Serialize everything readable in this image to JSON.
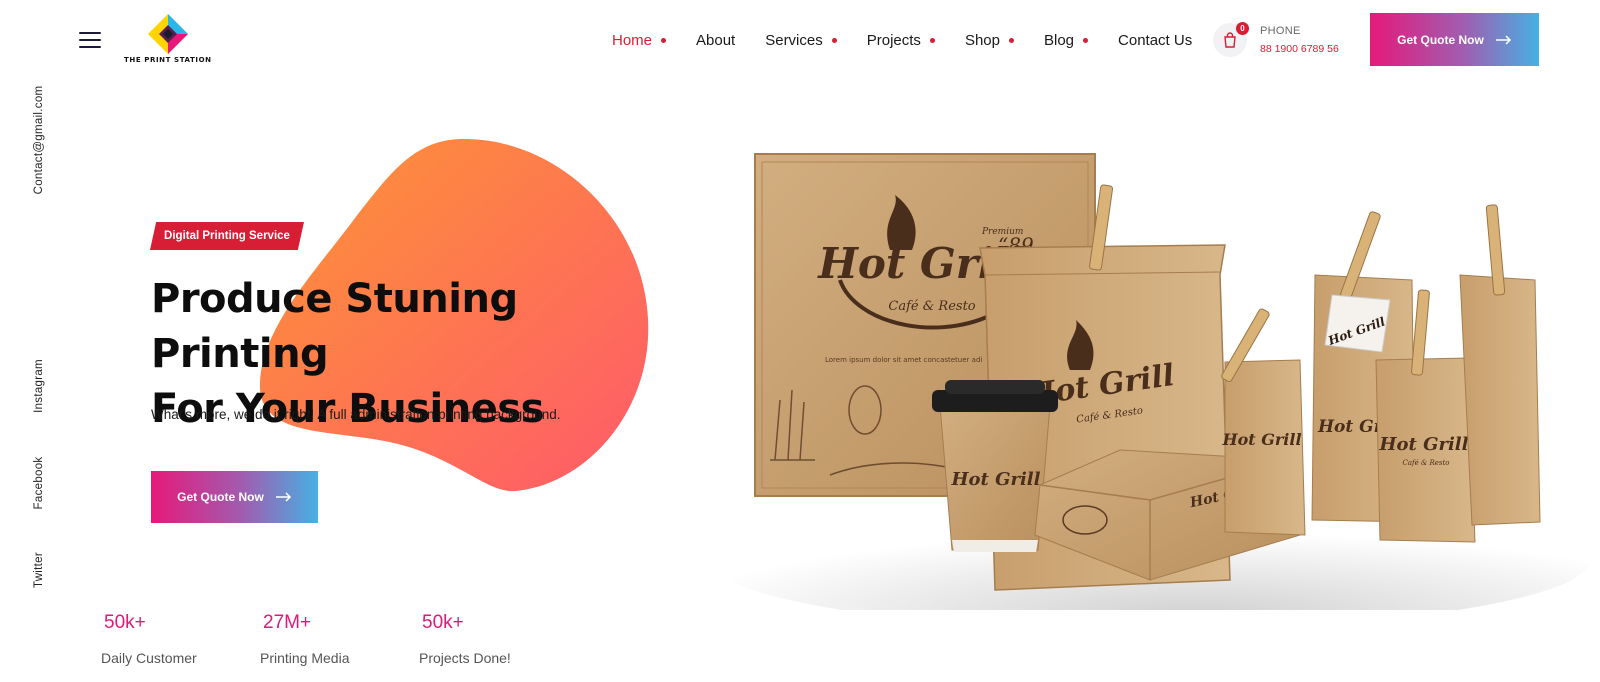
{
  "brand": {
    "logo_text": "THE PRINT STATION"
  },
  "nav": {
    "items": [
      {
        "label": "Home",
        "active": true,
        "has_dropdown": true
      },
      {
        "label": "About",
        "active": false,
        "has_dropdown": false
      },
      {
        "label": "Services",
        "active": false,
        "has_dropdown": true
      },
      {
        "label": "Projects",
        "active": false,
        "has_dropdown": true
      },
      {
        "label": "Shop",
        "active": false,
        "has_dropdown": true
      },
      {
        "label": "Blog",
        "active": false,
        "has_dropdown": true
      },
      {
        "label": "Contact Us",
        "active": false,
        "has_dropdown": false
      }
    ]
  },
  "cart": {
    "count": "0",
    "icon": "shopping-bag-icon"
  },
  "contact": {
    "phone_label": "PHONE",
    "phone_number": "88 1900 6789 56"
  },
  "cta": {
    "header_button": "Get Quote Now",
    "hero_button": "Get Quote Now"
  },
  "sidebar": {
    "email": "Contact@gmail.com",
    "social": [
      "Instagram",
      "Facebook",
      "Twitter"
    ]
  },
  "hero": {
    "badge": "Digital Printing Service",
    "title_line1": "Produce Stuning Printing",
    "title_line2": "For Your Business",
    "subtitle": "What’s more, we do it right! A full administration printing background."
  },
  "stats": [
    {
      "value": "50k+",
      "label": "Daily Customer"
    },
    {
      "value": "27M+",
      "label": "Printing Media"
    },
    {
      "value": "50k+",
      "label": "Projects Done!"
    }
  ],
  "product_image": {
    "brand": "Hot Grill",
    "tagline": "Café & Resto",
    "premium": "Premium",
    "year": "“89",
    "box_text": "Lorem ipsum dolor sit amet concastetuer adi"
  },
  "colors": {
    "accent_red": "#d81e35",
    "gradient_start": "#e6197a",
    "gradient_end": "#47b0e3",
    "blob_start": "#fd9535",
    "blob_end": "#fe5a6a",
    "kraft": "#c8a274"
  }
}
